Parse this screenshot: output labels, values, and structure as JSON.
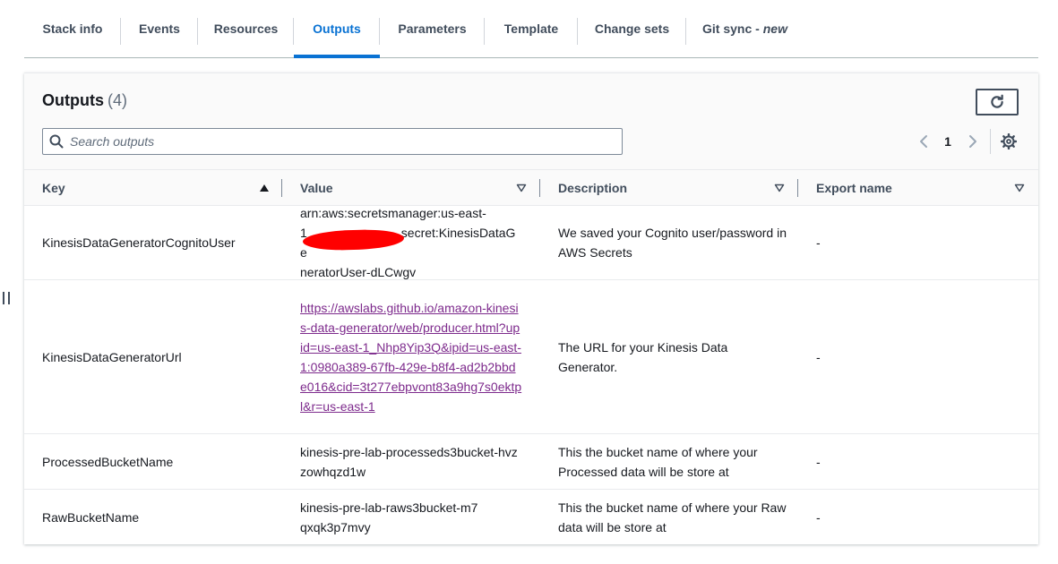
{
  "tabs": [
    {
      "label": "Stack info",
      "active": false
    },
    {
      "label": "Events",
      "active": false
    },
    {
      "label": "Resources",
      "active": false
    },
    {
      "label": "Outputs",
      "active": true
    },
    {
      "label": "Parameters",
      "active": false
    },
    {
      "label": "Template",
      "active": false
    },
    {
      "label": "Change sets",
      "active": false
    },
    {
      "label": "Git sync",
      "suffix": "new",
      "separator": " - ",
      "active": false
    }
  ],
  "panel": {
    "title": "Outputs",
    "count": "(4)",
    "refresh_icon": "refresh-icon"
  },
  "search": {
    "placeholder": "Search outputs",
    "value": "",
    "icon": "search-icon"
  },
  "pagination": {
    "current_page": "1",
    "prev_icon": "chevron-left-icon",
    "next_icon": "chevron-right-icon",
    "settings_icon": "gear-icon"
  },
  "table": {
    "columns": [
      {
        "label": "Key",
        "sort": "ascending"
      },
      {
        "label": "Value",
        "sort": "none"
      },
      {
        "label": "Description",
        "sort": "none"
      },
      {
        "label": "Export name",
        "sort": "none"
      }
    ],
    "rows": [
      {
        "key": "KinesisDataGeneratorCognitoUser",
        "value_line1": "arn:aws:secretsmanager:us-east-",
        "value_line2": "1",
        "value_line2_tail": "secret:KinesisDataGe",
        "value_line3": "neratorUser-dLCwgv",
        "description": "We saved your Cognito user/password in AWS Secrets",
        "export": "-"
      },
      {
        "key": "KinesisDataGeneratorUrl",
        "value_link": "https://awslabs.github.io/amazon-kinesis-data-generator/web/producer.html?upid=us-east-1_Nhp8Yip3Q&ipid=us-east-1:0980a389-67fb-429e-b8f4-ad2b2bbde016&cid=3t277ebpvont83a9hg7s0ektpl&r=us-east-1",
        "description": "The URL for your Kinesis Data Generator.",
        "export": "-"
      },
      {
        "key": "ProcessedBucketName",
        "value": "kinesis-pre-lab-processeds3bucket-hvzzowhqzd1w",
        "description": "This the bucket name of where your Processed data will be store at",
        "export": "-"
      },
      {
        "key": "RawBucketName",
        "value": "kinesis-pre-lab-raws3bucket-m7qxqk3p7mvy",
        "description": "This the bucket name of where your Raw data will be store at",
        "export": "-"
      }
    ]
  },
  "colors": {
    "accent": "#0972d3",
    "visited_link": "#7d2a8c",
    "redaction": "#ff0000"
  }
}
